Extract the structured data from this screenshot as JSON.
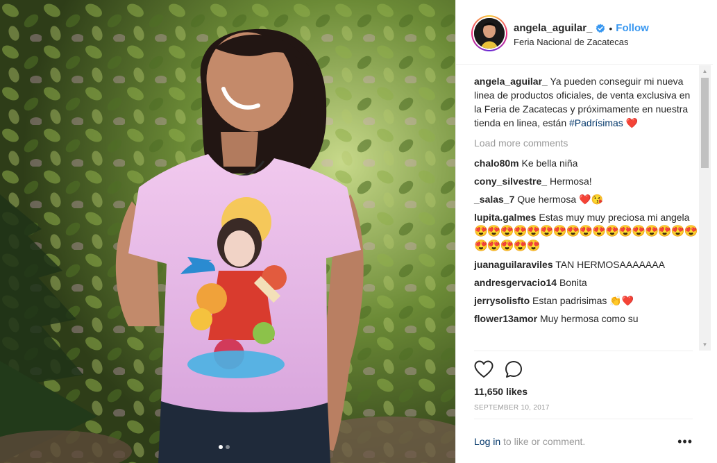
{
  "post": {
    "username": "angela_aguilar_",
    "follow_label": "Follow",
    "separator": "•",
    "location": "Feria Nacional de Zacatecas",
    "caption": {
      "user": "angela_aguilar_",
      "text": "Ya pueden conseguir mi nueva linea de productos oficiales, de venta exclusiva en la Feria de Zacatecas y próximamente en nuestra tienda en linea, están",
      "hashtag": "#Padrísimas",
      "emoji": "❤️"
    },
    "load_more": "Load more comments",
    "comments": [
      {
        "user": "chalo80m",
        "text": "Ke bella niña"
      },
      {
        "user": "cony_silvestre_",
        "text": "Hermosa!"
      },
      {
        "user": "_salas_7",
        "text": "Que hermosa ❤️😘"
      },
      {
        "user": "lupita.galmes",
        "text": "Estas muy muy preciosa mi angela"
      },
      {
        "user": "",
        "text": "😍😍😍😍😍😍😍😍😍😍😍😍😍😍😍😍😍😍😍😍😍😍"
      },
      {
        "user": "juanaguilaraviles",
        "text": "TAN HERMOSAAAAAAA"
      },
      {
        "user": "andresgervacio14",
        "text": "Bonita"
      },
      {
        "user": "jerrysolisfto",
        "text": "Estan padrisimas 👏❤️"
      },
      {
        "user": "flower13amor",
        "text": "Muy hermosa como su"
      }
    ],
    "likes": "11,650 likes",
    "date": "SEPTEMBER 10, 2017",
    "login_link": "Log in",
    "login_text": "to like or comment.",
    "more_label": "•••",
    "carousel": {
      "count": 2,
      "active": 1
    }
  },
  "icons": {
    "verified": "verified-badge-icon",
    "like": "heart-icon",
    "comment": "comment-bubble-icon",
    "more": "more-options-icon"
  },
  "colors": {
    "link": "#3897f0",
    "verified": "#3897f0",
    "muted": "#999999",
    "dark_link": "#003569"
  }
}
